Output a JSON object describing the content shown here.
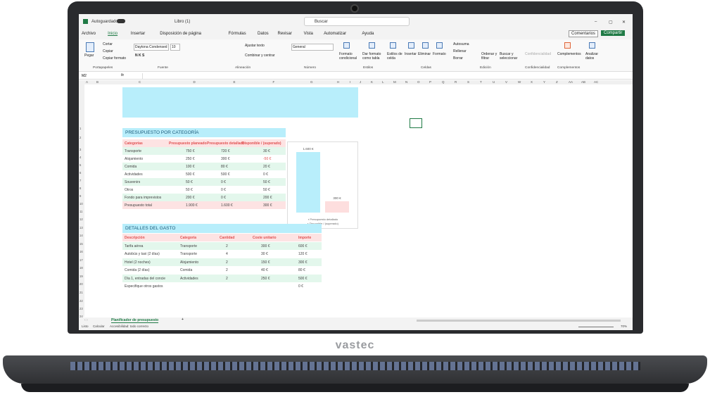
{
  "brand": "vastec",
  "titlebar": {
    "autosave": "Autoguardado",
    "filename": "Libro (1)",
    "search": "Buscar"
  },
  "menu": [
    "Archivo",
    "Inicio",
    "Insertar",
    "Disposición de página",
    "Fórmulas",
    "Datos",
    "Revisar",
    "Vista",
    "Automatizar",
    "Ayuda"
  ],
  "menu_right": {
    "comments": "Comentarios",
    "share": "Compartir"
  },
  "ribbon": {
    "clipboard": {
      "paste": "Pegar",
      "cut": "Cortar",
      "copy": "Copiar",
      "format": "Copiar formato",
      "group": "Portapapeles"
    },
    "font": {
      "name": "Daytona Condensed",
      "size": "10",
      "group": "Fuente"
    },
    "align": {
      "wrap": "Ajustar texto",
      "merge": "Combinar y centrar",
      "group": "Alineación"
    },
    "number": {
      "format": "General",
      "group": "Número"
    },
    "styles": {
      "cond": "Formato condicional",
      "table": "Dar formato como tabla",
      "cell": "Estilos de celda",
      "group": "Estilos"
    },
    "cells": {
      "insert": "Insertar",
      "delete": "Eliminar",
      "format": "Formato",
      "group": "Celdas"
    },
    "edit": {
      "autosum": "Autosuma",
      "fill": "Rellenar",
      "clear": "Borrar",
      "sort": "Ordenar y filtrar",
      "find": "Buscar y seleccionar",
      "group": "Edición"
    },
    "conf": {
      "label": "Confidencialidad",
      "group": "Confidencialidad"
    },
    "addins": {
      "label": "Complementos",
      "group": "Complementos"
    },
    "analyze": {
      "label": "Analizar datos"
    }
  },
  "formula": {
    "cell": "M2",
    "value": ""
  },
  "columns": [
    "A",
    "B",
    "C",
    "D",
    "E",
    "F",
    "G",
    "H",
    "I",
    "J",
    "K",
    "L",
    "M",
    "N",
    "O",
    "P",
    "Q",
    "R",
    "S",
    "T",
    "U",
    "V",
    "W",
    "X",
    "Y",
    "Z",
    "AA",
    "AB",
    "AC"
  ],
  "rows": [
    "1",
    "2",
    "3",
    "4",
    "5",
    "6",
    "7",
    "8",
    "9",
    "10",
    "11",
    "12",
    "13",
    "14",
    "15",
    "16",
    "17",
    "18",
    "19",
    "20",
    "21",
    "22",
    "23",
    "24"
  ],
  "budget": {
    "title": "PRESUPUESTO POR CATEGORÍA",
    "headers": [
      "Categorías",
      "Presupuesto planeado",
      "Presupuesto detallado",
      "Disponible / (superado)"
    ],
    "rows": [
      [
        "Transporte",
        "750 €",
        "720 €",
        "30 €"
      ],
      [
        "Alojamiento",
        "250 €",
        "300 €",
        "-50 €"
      ],
      [
        "Comida",
        "100 €",
        "80 €",
        "20 €"
      ],
      [
        "Actividades",
        "500 €",
        "500 €",
        "0 €"
      ],
      [
        "Souvenirs",
        "50 €",
        "0 €",
        "50 €"
      ],
      [
        "Otros",
        "50 €",
        "0 €",
        "50 €"
      ],
      [
        "Fondo para imprevistos",
        "200 €",
        "0 €",
        "200 €"
      ]
    ],
    "total": [
      "Presupuesto total",
      "1.900 €",
      "1.600 €",
      "300 €"
    ]
  },
  "chart_data": {
    "type": "bar",
    "categories": [
      "Presupuesto detallado",
      "Disponible / (superado)"
    ],
    "values": [
      1600,
      300
    ],
    "value_labels": [
      "1.600 €",
      "300 €"
    ],
    "colors": [
      "#b8eefb",
      "#fddede"
    ],
    "legend": [
      "Presupuesto detallado",
      "Disponible / (superado)"
    ]
  },
  "expenses": {
    "title": "DETALLES DEL GASTO",
    "headers": [
      "Descripción",
      "Categoría",
      "Cantidad",
      "Coste unitario",
      "Importe"
    ],
    "rows": [
      [
        "Tarifa aérea",
        "Transporte",
        "2",
        "300 €",
        "600 €"
      ],
      [
        "Autobús y taxi (2 días)",
        "Transporte",
        "4",
        "30 €",
        "120 €"
      ],
      [
        "Hotel (2 noches)",
        "Alojamiento",
        "2",
        "150 €",
        "300 €"
      ],
      [
        "Comida (2 días)",
        "Comida",
        "2",
        "40 €",
        "80 €"
      ],
      [
        "Día 1, entradas del concie",
        "Actividades",
        "2",
        "250 €",
        "500 €"
      ],
      [
        "Especifique otros gastos",
        "",
        "",
        "",
        "0 €"
      ]
    ]
  },
  "sheet": {
    "tab": "Planificador de presupuesto",
    "add": "+"
  },
  "status": {
    "ready": "Listo",
    "calc": "Calcular",
    "access": "Accesibilidad: todo correcto",
    "zoom": "70%"
  }
}
